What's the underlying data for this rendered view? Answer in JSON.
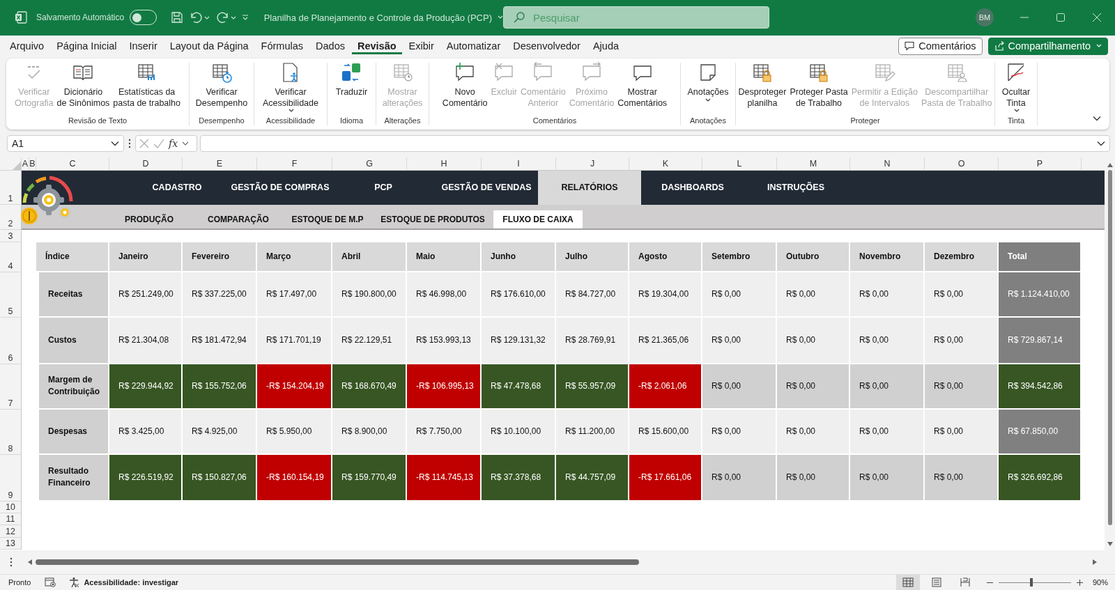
{
  "title_bar": {
    "autosave_label": "Salvamento Automático",
    "autosave_on": false,
    "document_title": "Planilha de Planejamento e Controle da Produção (PCP)",
    "search": {
      "placeholder": "Pesquisar"
    },
    "avatar": "BM"
  },
  "menu_tabs": [
    {
      "label": "Arquivo",
      "selected": false
    },
    {
      "label": "Página Inicial",
      "selected": false
    },
    {
      "label": "Inserir",
      "selected": false
    },
    {
      "label": "Layout da Página",
      "selected": false
    },
    {
      "label": "Fórmulas",
      "selected": false
    },
    {
      "label": "Dados",
      "selected": false
    },
    {
      "label": "Revisão",
      "selected": true
    },
    {
      "label": "Exibir",
      "selected": false
    },
    {
      "label": "Automatizar",
      "selected": false
    },
    {
      "label": "Desenvolvedor",
      "selected": false
    },
    {
      "label": "Ajuda",
      "selected": false
    }
  ],
  "header_buttons": [
    {
      "label": "Comentários",
      "kind": "outline"
    },
    {
      "label": "Compartilhamento",
      "kind": "primary"
    }
  ],
  "ribbon": {
    "groups": [
      {
        "name": "Revisão de Texto",
        "buttons": [
          {
            "label": "Verificar\nOrtografia",
            "disabled": true,
            "dropdown": false
          },
          {
            "label": "Dicionário\nde Sinônimos",
            "disabled": false,
            "dropdown": false
          },
          {
            "label": "Estatísticas da\npasta de trabalho",
            "disabled": false,
            "dropdown": false
          }
        ]
      },
      {
        "name": "Desempenho",
        "buttons": [
          {
            "label": "Verificar\nDesempenho",
            "disabled": false,
            "dropdown": false
          }
        ]
      },
      {
        "name": "Acessibilidade",
        "buttons": [
          {
            "label": "Verificar\nAcessibilidade",
            "disabled": false,
            "dropdown": true
          }
        ]
      },
      {
        "name": "Idioma",
        "buttons": [
          {
            "label": "Traduzir",
            "disabled": false,
            "dropdown": false
          }
        ]
      },
      {
        "name": "Alterações",
        "buttons": [
          {
            "label": "Mostrar\nalterações",
            "disabled": true,
            "dropdown": false
          }
        ]
      },
      {
        "name": "Comentários",
        "buttons": [
          {
            "label": "Novo\nComentário",
            "disabled": false,
            "dropdown": false
          },
          {
            "label": "Excluir",
            "disabled": true,
            "dropdown": false
          },
          {
            "label": "Comentário\nAnterior",
            "disabled": true,
            "dropdown": false
          },
          {
            "label": "Próximo\nComentário",
            "disabled": true,
            "dropdown": false
          },
          {
            "label": "Mostrar\nComentários",
            "disabled": false,
            "dropdown": false
          }
        ]
      },
      {
        "name": "Anotações",
        "buttons": [
          {
            "label": "Anotações",
            "disabled": false,
            "dropdown": true
          }
        ]
      },
      {
        "name": "Proteger",
        "buttons": [
          {
            "label": "Desproteger\nplanilha",
            "disabled": false,
            "dropdown": false
          },
          {
            "label": "Proteger Pasta\nde Trabalho",
            "disabled": false,
            "dropdown": false
          },
          {
            "label": "Permitir a Edição\nde Intervalos",
            "disabled": true,
            "dropdown": false
          },
          {
            "label": "Descompartilhar\nPasta de Trabalho",
            "disabled": true,
            "dropdown": false
          }
        ]
      },
      {
        "name": "Tinta",
        "buttons": [
          {
            "label": "Ocultar\nTinta",
            "disabled": false,
            "dropdown": true
          }
        ]
      }
    ]
  },
  "formula_bar": {
    "name_box": "A1",
    "function_label": "fx"
  },
  "sheet": {
    "column_headers": [
      "A",
      "B",
      "C",
      "D",
      "E",
      "F",
      "G",
      "H",
      "I",
      "J",
      "K",
      "L",
      "M",
      "N",
      "O",
      "P"
    ],
    "row_headers": [
      "1",
      "2",
      "3",
      "4",
      "5",
      "6",
      "7",
      "8",
      "9",
      "10",
      "11",
      "12",
      "13"
    ],
    "nav_tabs": [
      {
        "label": "CADASTRO",
        "selected": false
      },
      {
        "label": "GESTÃO DE COMPRAS",
        "selected": false
      },
      {
        "label": "PCP",
        "selected": false
      },
      {
        "label": "GESTÃO DE VENDAS",
        "selected": false
      },
      {
        "label": "RELATÓRIOS",
        "selected": true
      },
      {
        "label": "DASHBOARDS",
        "selected": false
      },
      {
        "label": "INSTRUÇÕES",
        "selected": false
      }
    ],
    "sub_tabs": [
      {
        "label": "PRODUÇÃO",
        "selected": false
      },
      {
        "label": "COMPARAÇÃO",
        "selected": false
      },
      {
        "label": "ESTOQUE DE M.P",
        "selected": false
      },
      {
        "label": "ESTOQUE DE PRODUTOS",
        "selected": false
      },
      {
        "label": "FLUXO DE CAIXA",
        "selected": true
      }
    ],
    "table": {
      "columns": [
        {
          "label": "Índice",
          "kind": "plain"
        },
        {
          "label": "Janeiro",
          "kind": "plain"
        },
        {
          "label": "Fevereiro",
          "kind": "plain"
        },
        {
          "label": "Março",
          "kind": "plain"
        },
        {
          "label": "Abril",
          "kind": "plain"
        },
        {
          "label": "Maio",
          "kind": "plain"
        },
        {
          "label": "Junho",
          "kind": "plain"
        },
        {
          "label": "Julho",
          "kind": "plain"
        },
        {
          "label": "Agosto",
          "kind": "plain"
        },
        {
          "label": "Setembro",
          "kind": "plain"
        },
        {
          "label": "Outubro",
          "kind": "plain"
        },
        {
          "label": "Novembro",
          "kind": "plain"
        },
        {
          "label": "Dezembro",
          "kind": "plain"
        },
        {
          "label": "Total",
          "kind": "total"
        }
      ],
      "rows": [
        {
          "cells": [
            {
              "text": "Receitas",
              "kind": "label"
            },
            {
              "text": "R$ 251.249,00",
              "kind": "plain"
            },
            {
              "text": "R$ 337.225,00",
              "kind": "plain"
            },
            {
              "text": "R$ 17.497,00",
              "kind": "plain"
            },
            {
              "text": "R$ 190.800,00",
              "kind": "plain"
            },
            {
              "text": "R$ 46.998,00",
              "kind": "plain"
            },
            {
              "text": "R$ 176.610,00",
              "kind": "plain"
            },
            {
              "text": "R$ 84.727,00",
              "kind": "plain"
            },
            {
              "text": "R$ 19.304,00",
              "kind": "plain"
            },
            {
              "text": "R$ 0,00",
              "kind": "plain"
            },
            {
              "text": "R$ 0,00",
              "kind": "plain"
            },
            {
              "text": "R$ 0,00",
              "kind": "plain"
            },
            {
              "text": "R$ 0,00",
              "kind": "plain"
            },
            {
              "text": "R$ 1.124.410,00",
              "kind": "total"
            }
          ]
        },
        {
          "cells": [
            {
              "text": "Custos",
              "kind": "label"
            },
            {
              "text": "R$ 21.304,08",
              "kind": "plain"
            },
            {
              "text": "R$ 181.472,94",
              "kind": "plain"
            },
            {
              "text": "R$ 171.701,19",
              "kind": "plain"
            },
            {
              "text": "R$ 22.129,51",
              "kind": "plain"
            },
            {
              "text": "R$ 153.993,13",
              "kind": "plain"
            },
            {
              "text": "R$ 129.131,32",
              "kind": "plain"
            },
            {
              "text": "R$ 28.769,91",
              "kind": "plain"
            },
            {
              "text": "R$ 21.365,06",
              "kind": "plain"
            },
            {
              "text": "R$ 0,00",
              "kind": "plain"
            },
            {
              "text": "R$ 0,00",
              "kind": "plain"
            },
            {
              "text": "R$ 0,00",
              "kind": "plain"
            },
            {
              "text": "R$ 0,00",
              "kind": "plain"
            },
            {
              "text": "R$ 729.867,14",
              "kind": "total"
            }
          ]
        },
        {
          "cells": [
            {
              "text": "Margem de\nContribuição",
              "kind": "label"
            },
            {
              "text": "R$ 229.944,92",
              "kind": "positive"
            },
            {
              "text": "R$ 155.752,06",
              "kind": "positive"
            },
            {
              "text": "-R$ 154.204,19",
              "kind": "negative"
            },
            {
              "text": "R$ 168.670,49",
              "kind": "positive"
            },
            {
              "text": "-R$ 106.995,13",
              "kind": "negative"
            },
            {
              "text": "R$ 47.478,68",
              "kind": "positive"
            },
            {
              "text": "R$ 55.957,09",
              "kind": "positive"
            },
            {
              "text": "-R$ 2.061,06",
              "kind": "negative"
            },
            {
              "text": "R$ 0,00",
              "kind": "neutral"
            },
            {
              "text": "R$ 0,00",
              "kind": "neutral"
            },
            {
              "text": "R$ 0,00",
              "kind": "neutral"
            },
            {
              "text": "R$ 0,00",
              "kind": "neutral"
            },
            {
              "text": "R$ 394.542,86",
              "kind": "positive"
            }
          ]
        },
        {
          "cells": [
            {
              "text": "Despesas",
              "kind": "label"
            },
            {
              "text": "R$ 3.425,00",
              "kind": "plain"
            },
            {
              "text": "R$ 4.925,00",
              "kind": "plain"
            },
            {
              "text": "R$ 5.950,00",
              "kind": "plain"
            },
            {
              "text": "R$ 8.900,00",
              "kind": "plain"
            },
            {
              "text": "R$ 7.750,00",
              "kind": "plain"
            },
            {
              "text": "R$ 10.100,00",
              "kind": "plain"
            },
            {
              "text": "R$ 11.200,00",
              "kind": "plain"
            },
            {
              "text": "R$ 15.600,00",
              "kind": "plain"
            },
            {
              "text": "R$ 0,00",
              "kind": "plain"
            },
            {
              "text": "R$ 0,00",
              "kind": "plain"
            },
            {
              "text": "R$ 0,00",
              "kind": "plain"
            },
            {
              "text": "R$ 0,00",
              "kind": "plain"
            },
            {
              "text": "R$ 67.850,00",
              "kind": "total"
            }
          ]
        },
        {
          "cells": [
            {
              "text": "Resultado\nFinanceiro",
              "kind": "label"
            },
            {
              "text": "R$ 226.519,92",
              "kind": "positive"
            },
            {
              "text": "R$ 150.827,06",
              "kind": "positive"
            },
            {
              "text": "-R$ 160.154,19",
              "kind": "negative"
            },
            {
              "text": "R$ 159.770,49",
              "kind": "positive"
            },
            {
              "text": "-R$ 114.745,13",
              "kind": "negative"
            },
            {
              "text": "R$ 37.378,68",
              "kind": "positive"
            },
            {
              "text": "R$ 44.757,09",
              "kind": "positive"
            },
            {
              "text": "-R$ 17.661,06",
              "kind": "negative"
            },
            {
              "text": "R$ 0,00",
              "kind": "neutral"
            },
            {
              "text": "R$ 0,00",
              "kind": "neutral"
            },
            {
              "text": "R$ 0,00",
              "kind": "neutral"
            },
            {
              "text": "R$ 0,00",
              "kind": "neutral"
            },
            {
              "text": "R$ 326.692,86",
              "kind": "positive"
            }
          ]
        }
      ]
    }
  },
  "status_bar": {
    "status": "Pronto",
    "accessibility": "Acessibilidade: investigar",
    "views": [
      {
        "selected": true
      },
      {
        "selected": false
      },
      {
        "selected": false
      }
    ],
    "zoom": {
      "level": 0.45,
      "reading": "90%"
    }
  }
}
